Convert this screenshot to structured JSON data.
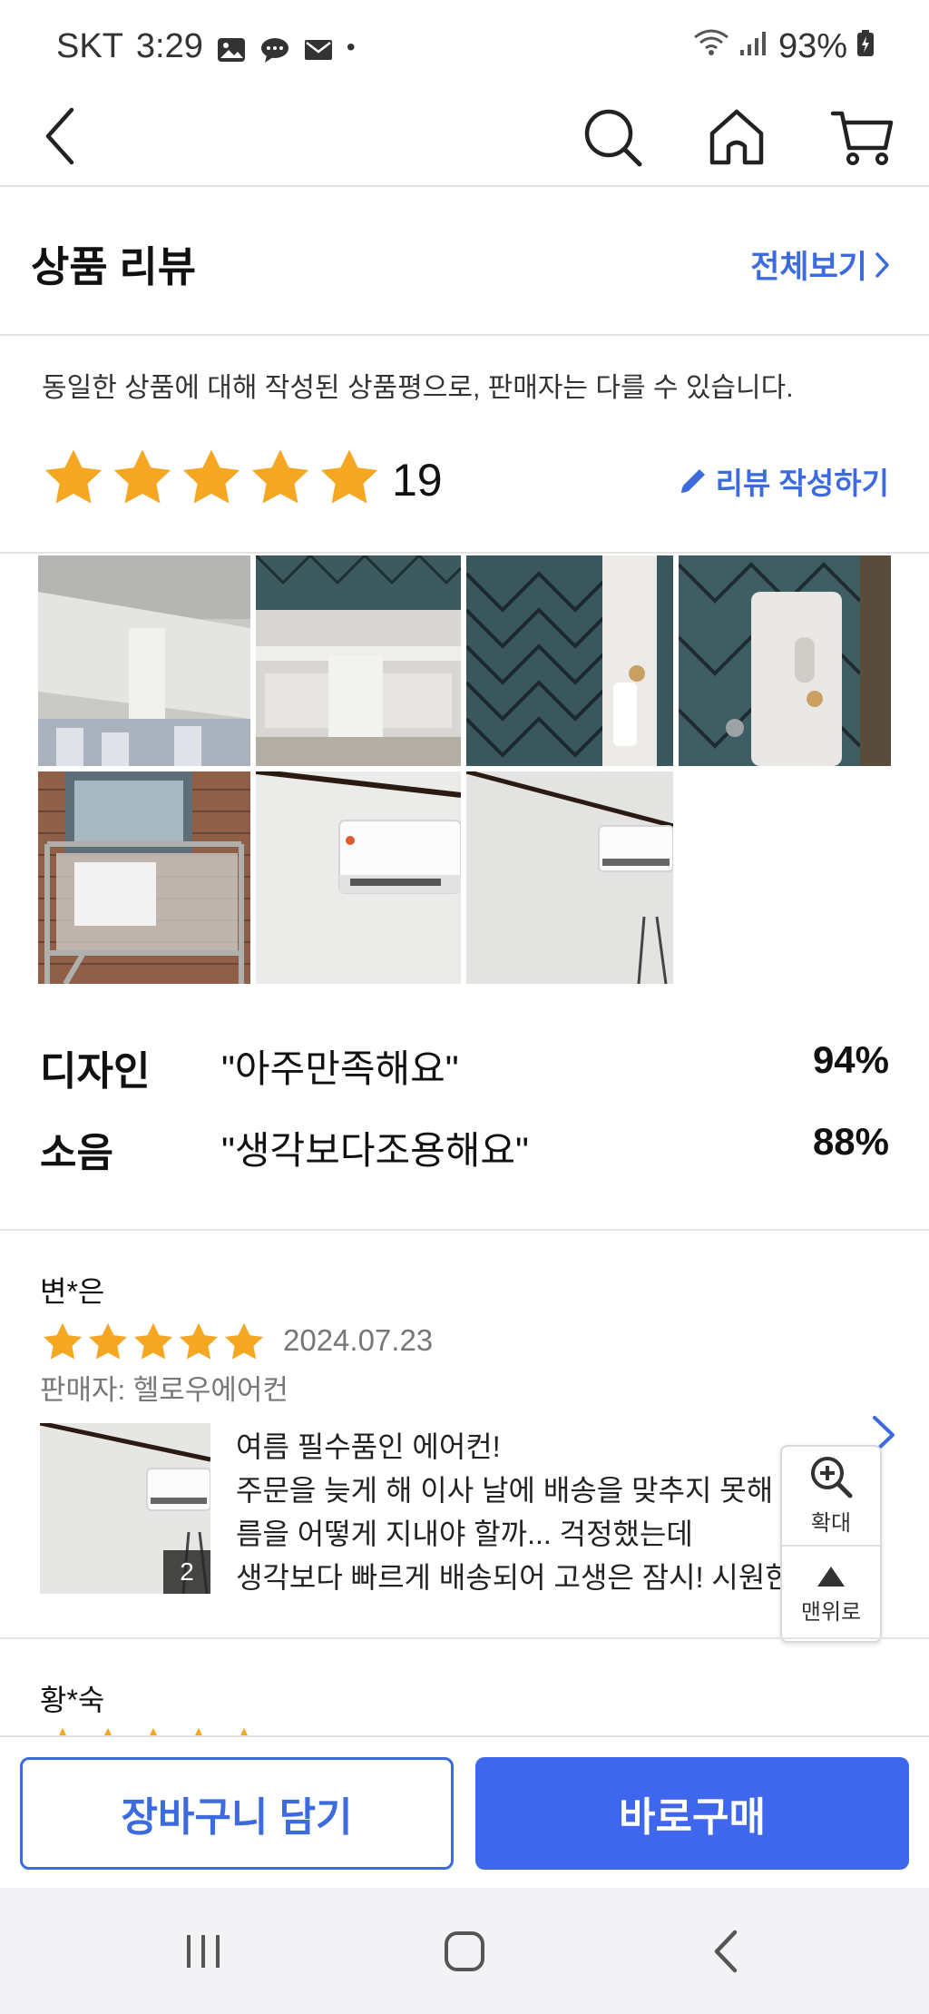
{
  "status_bar": {
    "carrier": "SKT",
    "time": "3:29",
    "battery": "93%",
    "dot": "•",
    "icons": [
      "gallery-icon",
      "chat-icon",
      "mail-icon",
      "wifi-icon",
      "signal-icon",
      "battery-icon"
    ]
  },
  "header": {
    "icons": [
      "back-arrow-icon",
      "search-icon",
      "home-icon",
      "cart-icon"
    ]
  },
  "section": {
    "title": "상품 리뷰",
    "view_all": "전체보기",
    "notice": "동일한 상품에 대해 작성된 상품평으로, 판매자는 다를 수 있습니다.",
    "rating_stars": 5,
    "review_count": "19",
    "write_review": "리뷰 작성하기"
  },
  "photos": [
    "balcony-bracket-photo",
    "bracket-mesh-photo",
    "mesh-bolt-photo",
    "mesh-bracket-photo",
    "outdoor-unit-rack-photo",
    "wall-ac-photo",
    "wall-ac-far-photo"
  ],
  "keywords": [
    {
      "name": "디자인",
      "value": "\"아주만족해요\"",
      "pct": "94%"
    },
    {
      "name": "소음",
      "value": "\"생각보다조용해요\"",
      "pct": "88%"
    }
  ],
  "reviews": [
    {
      "author": "변*은",
      "stars": 5,
      "date": "2024.07.23",
      "seller": "판매자: 헬로우에어컨",
      "photo_count": "2",
      "lines": [
        "여름 필수품인 에어컨!",
        "주문을 늦게 해 이사 날에 배송을 맞추지 못해 더운 여",
        "름을 어떻게 지내야 할까... 걱정했는데",
        "생각보다 빠르게 배송되어 고생은 잠시! 시원한 여..."
      ]
    },
    {
      "author": "황*숙",
      "stars": 5
    }
  ],
  "float_panel": {
    "zoom_label": "확대",
    "top_label": "맨위로"
  },
  "bottom_bar": {
    "cart_label": "장바구니 담기",
    "buy_label": "바로구매"
  },
  "colors": {
    "accent": "#3c6be0",
    "buy_button": "#3f67ee",
    "star": "#f5a623"
  }
}
